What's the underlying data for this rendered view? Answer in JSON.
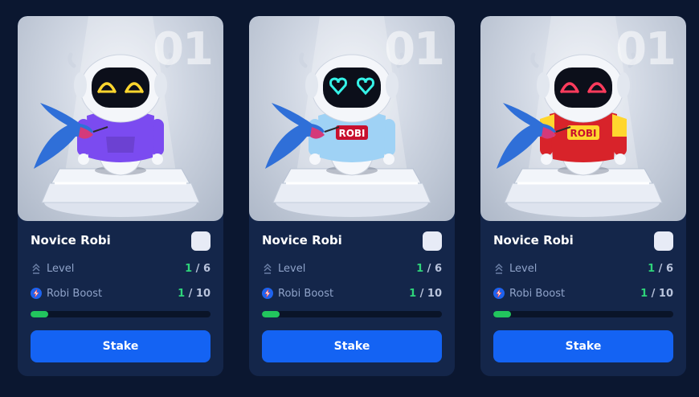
{
  "cards": [
    {
      "edition": "01",
      "name": "Novice Robi",
      "level_label": "Level",
      "level_current": "1",
      "level_total": " / 6",
      "boost_label": "Robi Boost",
      "boost_current": "1",
      "boost_total": " / 10",
      "boost_progress": 0.1,
      "stake_label": "Stake",
      "eyes": "happy",
      "eye_color": "#ffd62e",
      "outfit": "hoodie",
      "outfit_color": "#7b4bf0",
      "shirt_text": ""
    },
    {
      "edition": "01",
      "name": "Novice Robi",
      "level_label": "Level",
      "level_current": "1",
      "level_total": " / 6",
      "boost_label": "Robi Boost",
      "boost_current": "1",
      "boost_total": " / 10",
      "boost_progress": 0.1,
      "stake_label": "Stake",
      "eyes": "hearts",
      "eye_color": "#35f3e8",
      "outfit": "sweater",
      "outfit_color": "#9fd2f5",
      "shirt_text": "ROBI"
    },
    {
      "edition": "01",
      "name": "Novice Robi",
      "level_label": "Level",
      "level_current": "1",
      "level_total": " / 6",
      "boost_label": "Robi Boost",
      "boost_current": "1",
      "boost_total": " / 10",
      "boost_progress": 0.1,
      "stake_label": "Stake",
      "eyes": "happy",
      "eye_color": "#ff3b5c",
      "outfit": "jersey",
      "outfit_color": "#d8232a",
      "shirt_text": "ROBI"
    }
  ],
  "colors": {
    "page_bg": "#0b1730",
    "card_bg": "#14264a",
    "accent": "#1463f3",
    "progress": "#22c55e",
    "label": "#8fa3c9"
  }
}
